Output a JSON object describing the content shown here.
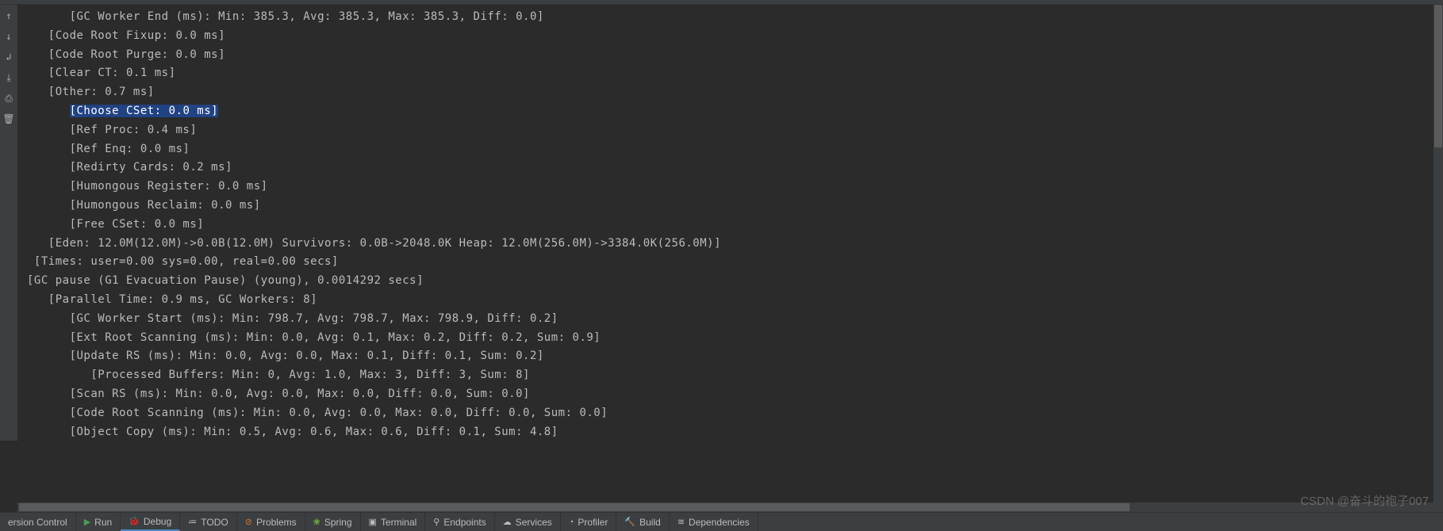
{
  "log_lines": [
    {
      "indent": 6,
      "text": "[GC Worker End (ms): Min: 385.3, Avg: 385.3, Max: 385.3, Diff: 0.0]"
    },
    {
      "indent": 3,
      "text": "[Code Root Fixup: 0.0 ms]"
    },
    {
      "indent": 3,
      "text": "[Code Root Purge: 0.0 ms]"
    },
    {
      "indent": 3,
      "text": "[Clear CT: 0.1 ms]"
    },
    {
      "indent": 3,
      "text": "[Other: 0.7 ms]"
    },
    {
      "indent": 6,
      "text": "[Choose CSet: 0.0 ms]",
      "highlighted": true
    },
    {
      "indent": 6,
      "text": "[Ref Proc: 0.4 ms]"
    },
    {
      "indent": 6,
      "text": "[Ref Enq: 0.0 ms]"
    },
    {
      "indent": 6,
      "text": "[Redirty Cards: 0.2 ms]"
    },
    {
      "indent": 6,
      "text": "[Humongous Register: 0.0 ms]"
    },
    {
      "indent": 6,
      "text": "[Humongous Reclaim: 0.0 ms]"
    },
    {
      "indent": 6,
      "text": "[Free CSet: 0.0 ms]"
    },
    {
      "indent": 3,
      "text": "[Eden: 12.0M(12.0M)->0.0B(12.0M) Survivors: 0.0B->2048.0K Heap: 12.0M(256.0M)->3384.0K(256.0M)]"
    },
    {
      "indent": 1,
      "text": "[Times: user=0.00 sys=0.00, real=0.00 secs]"
    },
    {
      "indent": 0,
      "text": "[GC pause (G1 Evacuation Pause) (young), 0.0014292 secs]"
    },
    {
      "indent": 3,
      "text": "[Parallel Time: 0.9 ms, GC Workers: 8]"
    },
    {
      "indent": 6,
      "text": "[GC Worker Start (ms): Min: 798.7, Avg: 798.7, Max: 798.9, Diff: 0.2]"
    },
    {
      "indent": 6,
      "text": "[Ext Root Scanning (ms): Min: 0.0, Avg: 0.1, Max: 0.2, Diff: 0.2, Sum: 0.9]"
    },
    {
      "indent": 6,
      "text": "[Update RS (ms): Min: 0.0, Avg: 0.0, Max: 0.1, Diff: 0.1, Sum: 0.2]"
    },
    {
      "indent": 9,
      "text": "[Processed Buffers: Min: 0, Avg: 1.0, Max: 3, Diff: 3, Sum: 8]"
    },
    {
      "indent": 6,
      "text": "[Scan RS (ms): Min: 0.0, Avg: 0.0, Max: 0.0, Diff: 0.0, Sum: 0.0]"
    },
    {
      "indent": 6,
      "text": "[Code Root Scanning (ms): Min: 0.0, Avg: 0.0, Max: 0.0, Diff: 0.0, Sum: 0.0]"
    },
    {
      "indent": 6,
      "text": "[Object Copy (ms): Min: 0.5, Avg: 0.6, Max: 0.6, Diff: 0.1, Sum: 4.8]"
    }
  ],
  "gutter_icons": [
    {
      "name": "scroll-to-top-icon",
      "glyph": "↑"
    },
    {
      "name": "scroll-to-bottom-icon",
      "glyph": "↓"
    },
    {
      "name": "soft-wrap-icon",
      "glyph": "↲"
    },
    {
      "name": "scroll-to-end-icon",
      "glyph": "⤓"
    },
    {
      "name": "print-icon",
      "glyph": "⎙"
    },
    {
      "name": "clear-all-icon",
      "glyph": "🗑"
    }
  ],
  "status_bar": [
    {
      "name": "version-control",
      "label": "ersion Control",
      "icon": ""
    },
    {
      "name": "run",
      "label": "Run",
      "icon": "▶",
      "icon_class": "play-icon"
    },
    {
      "name": "debug",
      "label": "Debug",
      "icon": "🐞",
      "icon_class": "bug-icon",
      "active": true
    },
    {
      "name": "todo",
      "label": "TODO",
      "icon": "≔"
    },
    {
      "name": "problems",
      "label": "Problems",
      "icon": "⊘",
      "icon_class": "orange-icon"
    },
    {
      "name": "spring",
      "label": "Spring",
      "icon": "❀",
      "icon_class": "spring-icon"
    },
    {
      "name": "terminal",
      "label": "Terminal",
      "icon": "▣"
    },
    {
      "name": "endpoints",
      "label": "Endpoints",
      "icon": "⚲"
    },
    {
      "name": "services",
      "label": "Services",
      "icon": "☁"
    },
    {
      "name": "profiler",
      "label": "Profiler",
      "icon": "◔"
    },
    {
      "name": "build",
      "label": "Build",
      "icon": "🔨"
    },
    {
      "name": "dependencies",
      "label": "Dependencies",
      "icon": "≋"
    }
  ],
  "watermark": "CSDN @奋斗的袍子007"
}
